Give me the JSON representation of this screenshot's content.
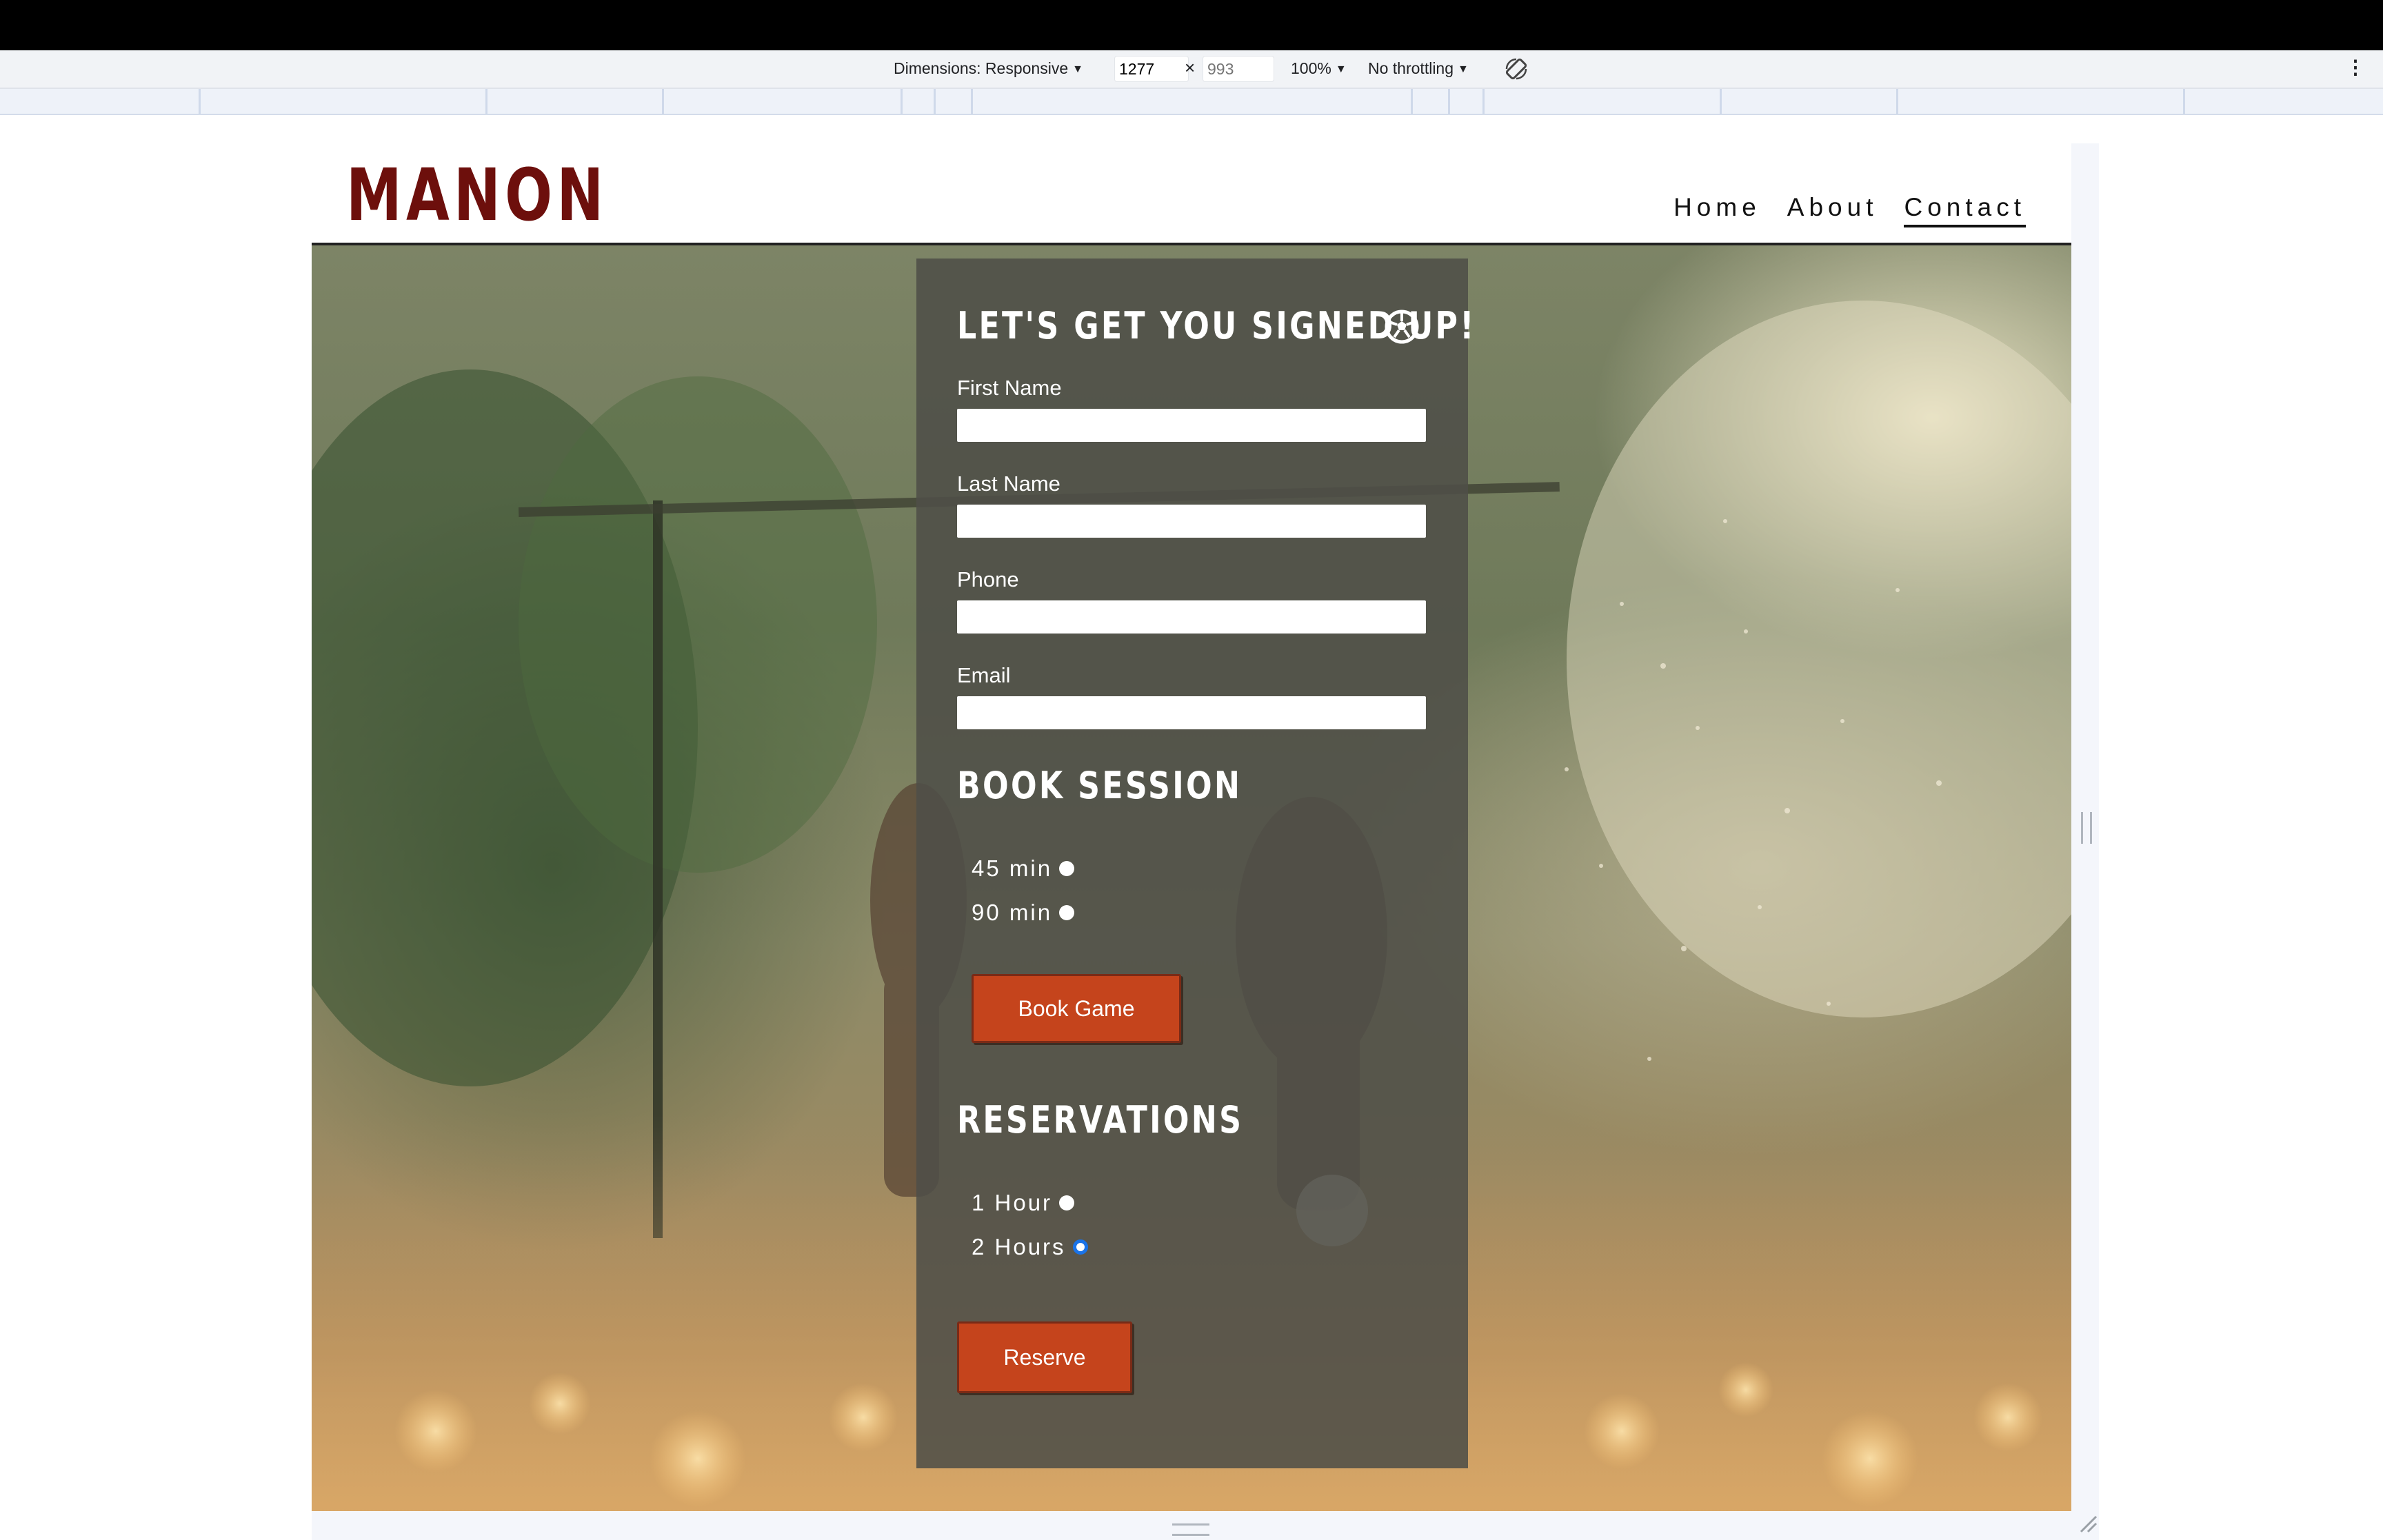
{
  "devtools": {
    "dimensions_label": "Dimensions: Responsive",
    "width_value": "1277",
    "times_sign": "×",
    "height_placeholder": "993",
    "zoom_label": "100%",
    "throttling_label": "No throttling",
    "more_icon": "⋮",
    "rotate_icon": "rotate-icon"
  },
  "site": {
    "logo": "MANON",
    "nav": [
      {
        "label": "Home"
      },
      {
        "label": "About"
      },
      {
        "label": "Contact"
      }
    ],
    "active_nav": "Contact",
    "accent_color": "#6d0f0c"
  },
  "form": {
    "title": "LET'S GET YOU SIGNED UP!",
    "title_icon": "soccer-ball-icon",
    "fields": [
      {
        "label": "First Name",
        "value": ""
      },
      {
        "label": "Last Name",
        "value": ""
      },
      {
        "label": "Phone",
        "value": ""
      },
      {
        "label": "Email",
        "value": ""
      }
    ],
    "session": {
      "heading": "BOOK SESSION",
      "options": [
        {
          "label": "45 min",
          "selected": false
        },
        {
          "label": "90 min",
          "selected": false
        }
      ],
      "button": "Book Game"
    },
    "reservations": {
      "heading": "RESERVATIONS",
      "options": [
        {
          "label": "1 Hour",
          "selected": false
        },
        {
          "label": "2 Hours",
          "selected": true
        }
      ],
      "button": "Reserve"
    },
    "button_color": "#c5441c"
  }
}
